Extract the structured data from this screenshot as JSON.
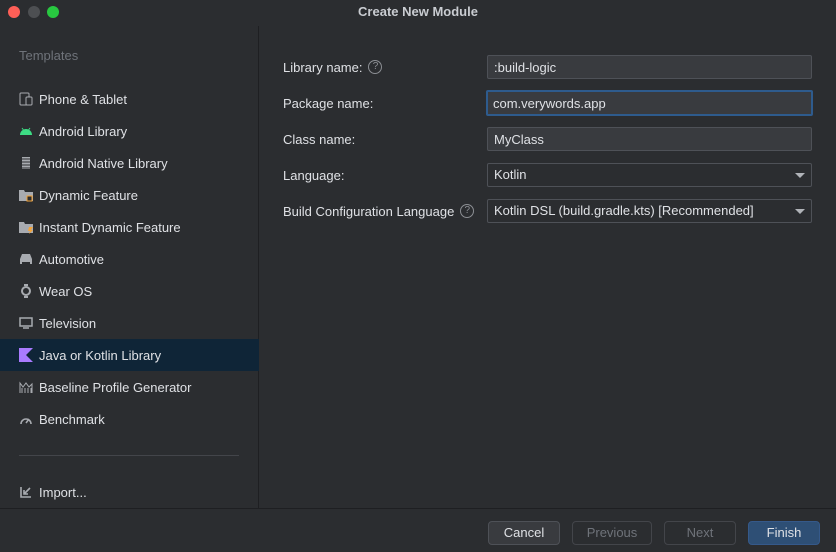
{
  "window": {
    "title": "Create New Module"
  },
  "sidebar": {
    "title": "Templates",
    "items": [
      {
        "label": "Phone & Tablet",
        "icon": "phone-tablet-icon"
      },
      {
        "label": "Android Library",
        "icon": "android-icon"
      },
      {
        "label": "Android Native Library",
        "icon": "chip-icon"
      },
      {
        "label": "Dynamic Feature",
        "icon": "folder-module-icon"
      },
      {
        "label": "Instant Dynamic Feature",
        "icon": "folder-instant-icon"
      },
      {
        "label": "Automotive",
        "icon": "car-icon"
      },
      {
        "label": "Wear OS",
        "icon": "watch-icon"
      },
      {
        "label": "Television",
        "icon": "tv-icon"
      },
      {
        "label": "Java or Kotlin Library",
        "icon": "kotlin-icon",
        "selected": true
      },
      {
        "label": "Baseline Profile Generator",
        "icon": "chart-icon"
      },
      {
        "label": "Benchmark",
        "icon": "gauge-icon"
      }
    ],
    "import_label": "Import..."
  },
  "form": {
    "library_name": {
      "label": "Library name:",
      "value": ":build-logic"
    },
    "package_name": {
      "label": "Package name:",
      "value": "com.verywords.app"
    },
    "class_name": {
      "label": "Class name:",
      "value": "MyClass"
    },
    "language": {
      "label": "Language:",
      "value": "Kotlin"
    },
    "build_config": {
      "label": "Build Configuration Language",
      "value": "Kotlin DSL (build.gradle.kts) [Recommended]"
    },
    "help_glyph": "?"
  },
  "buttons": {
    "cancel": "Cancel",
    "previous": "Previous",
    "next": "Next",
    "finish": "Finish"
  },
  "colors": {
    "accent": "#2e5b8d",
    "selection": "#0f2537",
    "android": "#3ddc84",
    "kotlin": "#a97bff"
  }
}
